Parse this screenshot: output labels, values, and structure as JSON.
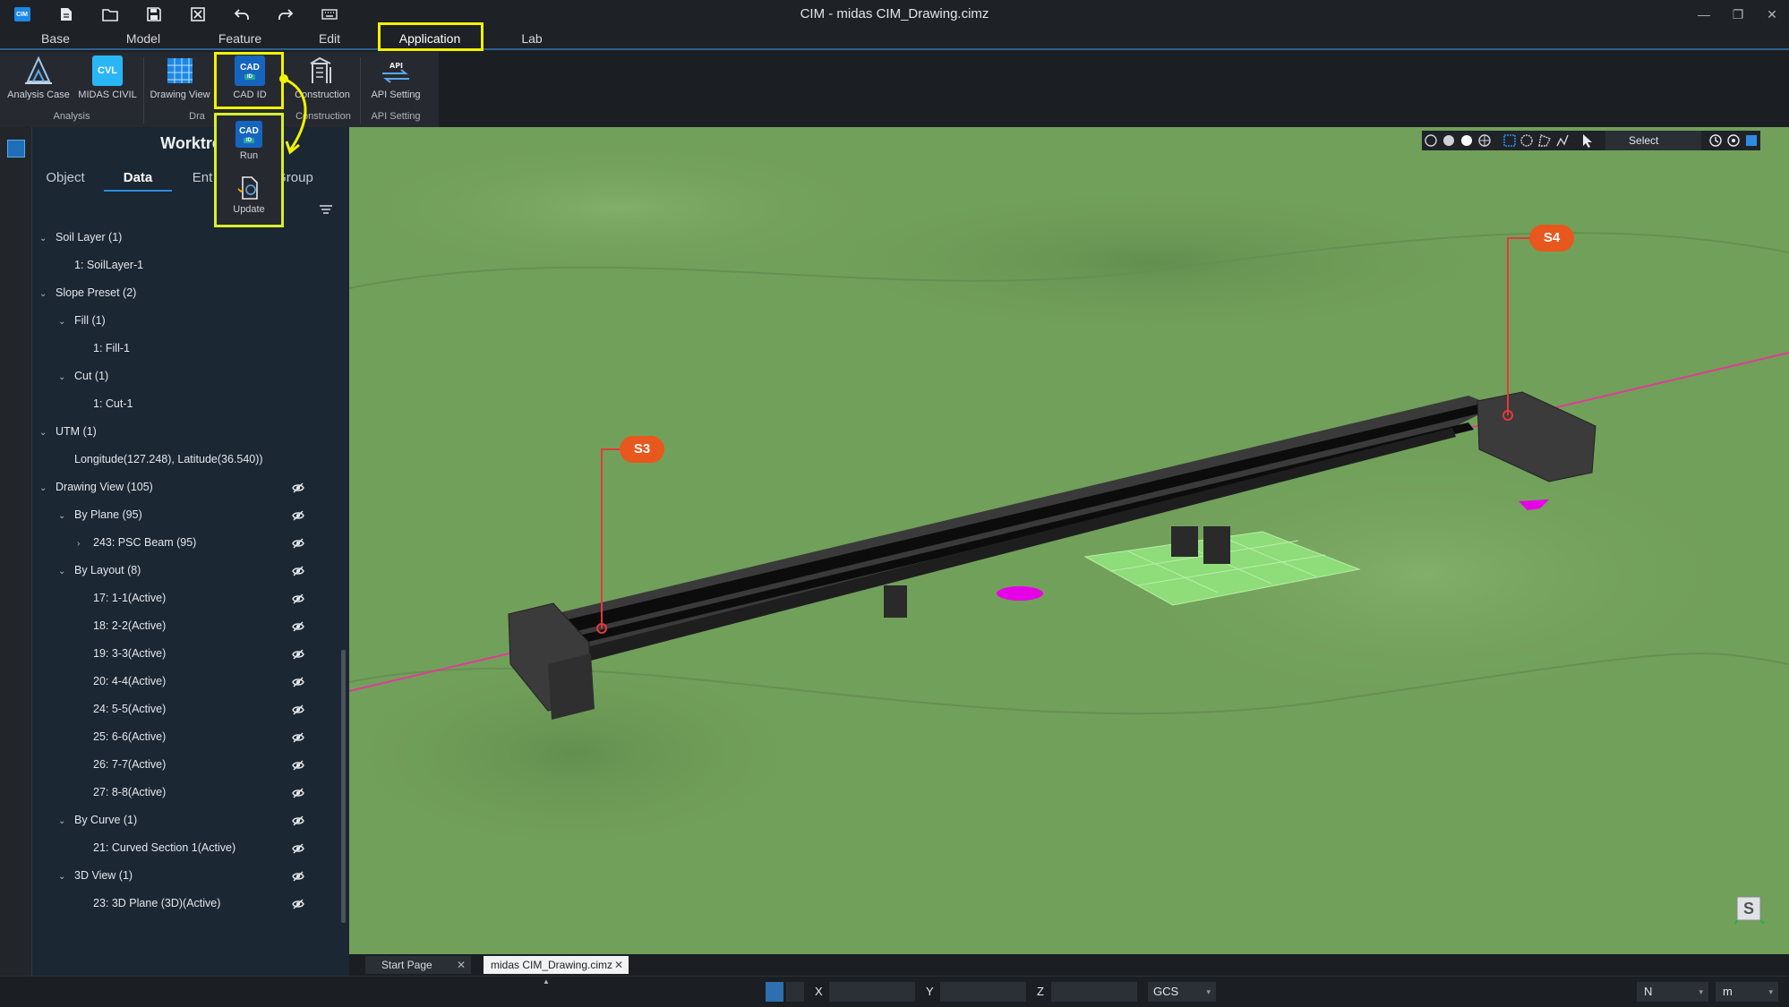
{
  "window": {
    "title": "CIM - midas CIM_Drawing.cimz",
    "app_logo": "CIM"
  },
  "quick_access": {
    "icons": [
      "app-logo",
      "new-file-icon",
      "open-folder-icon",
      "save-icon",
      "close-file-icon",
      "undo-icon",
      "redo-icon",
      "keyboard-icon"
    ]
  },
  "menu": {
    "tabs": [
      "Base",
      "Model",
      "Feature",
      "Edit",
      "Application",
      "Lab"
    ],
    "active": "Application"
  },
  "ribbon": {
    "items": {
      "analysis_case": "Analysis Case",
      "midas_civil": "MIDAS CIVIL",
      "midas_civil_badge": "CVL",
      "drawing_view": "Drawing View",
      "cad_id": "CAD ID",
      "cad_badge": "CAD",
      "cad_sub": "ID",
      "construction": "Construction",
      "api_setting": "API Setting",
      "api_badge": "API"
    },
    "groups": {
      "analysis": "Analysis",
      "drawing_partial": "Dra",
      "construction": "Construction",
      "api_setting": "API Setting"
    }
  },
  "cad_dropdown": {
    "run": "Run",
    "update": "Update"
  },
  "panel": {
    "title_partial": "Worktre",
    "tabs": {
      "object": "Object",
      "data": "Data",
      "entity_partial": "Ent",
      "group_partial": "Group"
    },
    "active_tab": "Data"
  },
  "tree": [
    {
      "label": "Soil Layer (1)",
      "level": 0,
      "expand": "open",
      "eye": false
    },
    {
      "label": "1: SoilLayer-1",
      "level": 1,
      "expand": "none",
      "eye": false
    },
    {
      "label": "Slope Preset (2)",
      "level": 0,
      "expand": "open",
      "eye": false
    },
    {
      "label": "Fill (1)",
      "level": 1,
      "expand": "open",
      "eye": false
    },
    {
      "label": "1: Fill-1",
      "level": 2,
      "expand": "none",
      "eye": false
    },
    {
      "label": "Cut (1)",
      "level": 1,
      "expand": "open",
      "eye": false
    },
    {
      "label": "1: Cut-1",
      "level": 2,
      "expand": "none",
      "eye": false
    },
    {
      "label": "UTM (1)",
      "level": 0,
      "expand": "open",
      "eye": false
    },
    {
      "label": "Longitude(127.248), Latitude(36.540))",
      "level": 1,
      "expand": "none",
      "eye": false
    },
    {
      "label": "Drawing View (105)",
      "level": 0,
      "expand": "open",
      "eye": true
    },
    {
      "label": "By Plane (95)",
      "level": 1,
      "expand": "open",
      "eye": true
    },
    {
      "label": "243: PSC Beam (95)",
      "level": 2,
      "expand": "closed",
      "eye": true
    },
    {
      "label": "By Layout (8)",
      "level": 1,
      "expand": "open",
      "eye": true
    },
    {
      "label": "17: 1-1(Active)",
      "level": 2,
      "expand": "none",
      "eye": true
    },
    {
      "label": "18: 2-2(Active)",
      "level": 2,
      "expand": "none",
      "eye": true
    },
    {
      "label": "19: 3-3(Active)",
      "level": 2,
      "expand": "none",
      "eye": true
    },
    {
      "label": "20: 4-4(Active)",
      "level": 2,
      "expand": "none",
      "eye": true
    },
    {
      "label": "24: 5-5(Active)",
      "level": 2,
      "expand": "none",
      "eye": true
    },
    {
      "label": "25: 6-6(Active)",
      "level": 2,
      "expand": "none",
      "eye": true
    },
    {
      "label": "26: 7-7(Active)",
      "level": 2,
      "expand": "none",
      "eye": true
    },
    {
      "label": "27: 8-8(Active)",
      "level": 2,
      "expand": "none",
      "eye": true
    },
    {
      "label": "By Curve (1)",
      "level": 1,
      "expand": "open",
      "eye": true
    },
    {
      "label": "21: Curved Section 1(Active)",
      "level": 2,
      "expand": "none",
      "eye": true
    },
    {
      "label": "3D View (1)",
      "level": 1,
      "expand": "open",
      "eye": true
    },
    {
      "label": "23: 3D Plane (3D)(Active)",
      "level": 2,
      "expand": "none",
      "eye": true
    }
  ],
  "viewport": {
    "select_label": "Select",
    "callouts": {
      "s3": "S3",
      "s4": "S4"
    },
    "nav_cube_label": "S",
    "colors": {
      "terrain": "#71a05a",
      "callout": "#e8571d",
      "axis": "#e23a9a",
      "highlight": "#f2f200"
    }
  },
  "doc_tabs": {
    "start_page": "Start Page",
    "drawing": "midas CIM_Drawing.cimz"
  },
  "status": {
    "x_label": "X",
    "y_label": "Y",
    "z_label": "Z",
    "x_value": "",
    "y_value": "",
    "z_value": "",
    "coord_system": "GCS",
    "direction": "N",
    "unit": "m"
  }
}
